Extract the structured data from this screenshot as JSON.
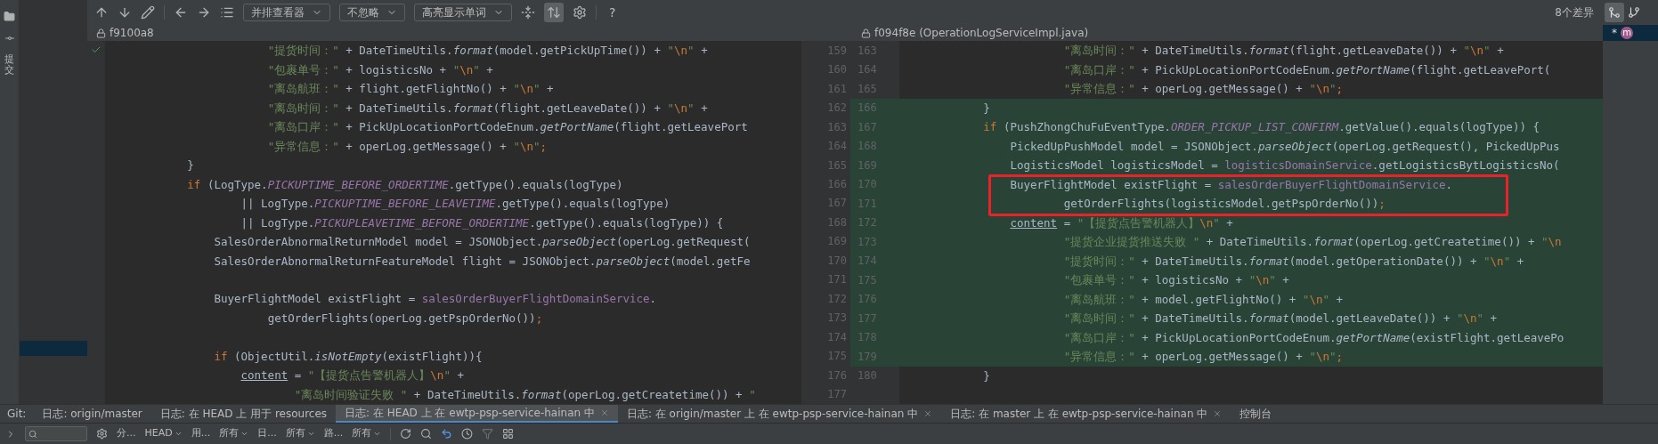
{
  "sidebar": {
    "label": "提交"
  },
  "toolbar": {
    "dropdowns": [
      "并排查看器",
      "不忽略",
      "高亮显示单词"
    ],
    "sync_toggle": {
      "on": true
    },
    "help": "?",
    "diff_count": "8个差异"
  },
  "left_pane": {
    "revision": "f9100a8",
    "lines": [
      {
        "number": "159",
        "code": [
          {
            "kind": "s",
            "text": "                        \"提货时间：\""
          },
          {
            "kind": "p",
            "text": " + DateTimeUtils."
          },
          {
            "kind": "i",
            "text": "format"
          },
          {
            "kind": "p",
            "text": "(model.getPickUpTime()) + "
          },
          {
            "kind": "s",
            "text": "\""
          },
          {
            "kind": "e",
            "text": "\\n"
          },
          {
            "kind": "s",
            "text": "\""
          },
          {
            "kind": "p",
            "text": " +"
          }
        ]
      },
      {
        "number": "160",
        "code": [
          {
            "kind": "s",
            "text": "                        \"包裹单号：\""
          },
          {
            "kind": "p",
            "text": " + logisticsNo + "
          },
          {
            "kind": "s",
            "text": "\""
          },
          {
            "kind": "e",
            "text": "\\n"
          },
          {
            "kind": "s",
            "text": "\""
          },
          {
            "kind": "p",
            "text": " +"
          }
        ]
      },
      {
        "number": "161",
        "code": [
          {
            "kind": "s",
            "text": "                        \"离岛航班：\""
          },
          {
            "kind": "p",
            "text": " + flight.getFlightNo() + "
          },
          {
            "kind": "s",
            "text": "\""
          },
          {
            "kind": "e",
            "text": "\\n"
          },
          {
            "kind": "s",
            "text": "\""
          },
          {
            "kind": "p",
            "text": " +"
          }
        ]
      },
      {
        "number": "162",
        "code": [
          {
            "kind": "s",
            "text": "                        \"离岛时间：\""
          },
          {
            "kind": "p",
            "text": " + DateTimeUtils."
          },
          {
            "kind": "i",
            "text": "format"
          },
          {
            "kind": "p",
            "text": "(flight.getLeaveDate()) + "
          },
          {
            "kind": "s",
            "text": "\""
          },
          {
            "kind": "e",
            "text": "\\n"
          },
          {
            "kind": "s",
            "text": "\""
          },
          {
            "kind": "p",
            "text": " +"
          }
        ]
      },
      {
        "number": "163",
        "code": [
          {
            "kind": "s",
            "text": "                        \"离岛口岸：\""
          },
          {
            "kind": "p",
            "text": " + PickUpLocationPortCodeEnum."
          },
          {
            "kind": "i",
            "text": "getPortName"
          },
          {
            "kind": "p",
            "text": "(flight.getLeavePort"
          }
        ]
      },
      {
        "number": "164",
        "code": [
          {
            "kind": "s",
            "text": "                        \"异常信息：\""
          },
          {
            "kind": "p",
            "text": " + operLog.getMessage() + "
          },
          {
            "kind": "s",
            "text": "\""
          },
          {
            "kind": "e",
            "text": "\\n"
          },
          {
            "kind": "s",
            "text": "\""
          },
          {
            "kind": "k",
            "text": ";"
          }
        ]
      },
      {
        "number": "165",
        "code": [
          {
            "kind": "p",
            "text": "            }"
          }
        ]
      },
      {
        "number": "166",
        "code": [
          {
            "kind": "k",
            "text": "            if"
          },
          {
            "kind": "p",
            "text": " (LogType."
          },
          {
            "kind": "c",
            "text": "PICKUPTIME_BEFORE_ORDERTIME"
          },
          {
            "kind": "p",
            "text": ".getType().equals(logType)"
          }
        ]
      },
      {
        "number": "167",
        "code": [
          {
            "kind": "p",
            "text": "                    || LogType."
          },
          {
            "kind": "c",
            "text": "PICKUPTIME_BEFORE_LEAVETIME"
          },
          {
            "kind": "p",
            "text": ".getType().equals(logType)"
          }
        ]
      },
      {
        "number": "168",
        "code": [
          {
            "kind": "p",
            "text": "                    || LogType."
          },
          {
            "kind": "c",
            "text": "PICKUPLEAVETIME_BEFORE_ORDERTIME"
          },
          {
            "kind": "p",
            "text": ".getType().equals(logType)) {"
          }
        ]
      },
      {
        "number": "169",
        "code": [
          {
            "kind": "p",
            "text": "                SalesOrderAbnormalReturnModel model = JSONObject."
          },
          {
            "kind": "i",
            "text": "parseObject"
          },
          {
            "kind": "p",
            "text": "(operLog.getRequest("
          }
        ]
      },
      {
        "number": "170",
        "code": [
          {
            "kind": "p",
            "text": "                SalesOrderAbnormalReturnFeatureModel flight = JSONObject."
          },
          {
            "kind": "i",
            "text": "parseObject"
          },
          {
            "kind": "p",
            "text": "(model.getFe"
          }
        ]
      },
      {
        "number": "171"
      },
      {
        "number": "172",
        "code": [
          {
            "kind": "p",
            "text": "                BuyerFlightModel existFlight = "
          },
          {
            "kind": "f",
            "text": "salesOrderBuyerFlightDomainService"
          },
          {
            "kind": "p",
            "text": "."
          }
        ]
      },
      {
        "number": "173",
        "code": [
          {
            "kind": "p",
            "text": "                        getOrderFlights(operLog.getPspOrderNo())"
          },
          {
            "kind": "k",
            "text": ";"
          }
        ]
      },
      {
        "number": "174"
      },
      {
        "number": "175",
        "code": [
          {
            "kind": "k",
            "text": "                if"
          },
          {
            "kind": "p",
            "text": " (ObjectUtil."
          },
          {
            "kind": "i",
            "text": "isNotEmpty"
          },
          {
            "kind": "p",
            "text": "(existFlight)){"
          }
        ]
      },
      {
        "number": "176",
        "code": [
          {
            "kind": "u",
            "text": "                    content"
          },
          {
            "kind": "p",
            "text": " = "
          },
          {
            "kind": "s",
            "text": "\"【提货点告警机器人】"
          },
          {
            "kind": "e",
            "text": "\\n"
          },
          {
            "kind": "s",
            "text": "\""
          },
          {
            "kind": "p",
            "text": " +"
          }
        ]
      },
      {
        "number": "177",
        "code": [
          {
            "kind": "s",
            "text": "                            \"离岛时间验证失败 \""
          },
          {
            "kind": "p",
            "text": " + DateTimeUtils."
          },
          {
            "kind": "i",
            "text": "format"
          },
          {
            "kind": "p",
            "text": "(operLog.getCreatetime()) + "
          },
          {
            "kind": "s",
            "text": "\""
          }
        ]
      }
    ]
  },
  "right_pane": {
    "revision": "f094f8e (OperationLogServiceImpl.java)",
    "lines": [
      {
        "number": "163",
        "added": false,
        "boxed": false,
        "code": [
          {
            "kind": "s",
            "text": "                        \"离岛时间：\""
          },
          {
            "kind": "p",
            "text": " + DateTimeUtils."
          },
          {
            "kind": "i",
            "text": "format"
          },
          {
            "kind": "p",
            "text": "(flight.getLeaveDate()) + "
          },
          {
            "kind": "s",
            "text": "\""
          },
          {
            "kind": "e",
            "text": "\\n"
          },
          {
            "kind": "s",
            "text": "\""
          },
          {
            "kind": "p",
            "text": " +"
          }
        ]
      },
      {
        "number": "164",
        "added": false,
        "boxed": false,
        "code": [
          {
            "kind": "s",
            "text": "                        \"离岛口岸：\""
          },
          {
            "kind": "p",
            "text": " + PickUpLocationPortCodeEnum."
          },
          {
            "kind": "i",
            "text": "getPortName"
          },
          {
            "kind": "p",
            "text": "(flight.getLeavePort("
          }
        ]
      },
      {
        "number": "165",
        "added": false,
        "boxed": false,
        "code": [
          {
            "kind": "s",
            "text": "                        \"异常信息：\""
          },
          {
            "kind": "p",
            "text": " + operLog.getMessage() + "
          },
          {
            "kind": "s",
            "text": "\""
          },
          {
            "kind": "e",
            "text": "\\n"
          },
          {
            "kind": "s",
            "text": "\""
          },
          {
            "kind": "k",
            "text": ";"
          }
        ]
      },
      {
        "number": "166",
        "added": true,
        "boxed": false,
        "code": [
          {
            "kind": "p",
            "text": "            }"
          }
        ]
      },
      {
        "number": "167",
        "added": true,
        "boxed": false,
        "code": [
          {
            "kind": "k",
            "text": "            if"
          },
          {
            "kind": "p",
            "text": " (PushZhongChuFuEventType."
          },
          {
            "kind": "c",
            "text": "ORDER_PICKUP_LIST_CONFIRM"
          },
          {
            "kind": "p",
            "text": ".getValue().equals(logType)) {"
          }
        ]
      },
      {
        "number": "168",
        "added": true,
        "boxed": false,
        "code": [
          {
            "kind": "p",
            "text": "                PickedUpPushModel model = JSONObject."
          },
          {
            "kind": "i",
            "text": "parseObject"
          },
          {
            "kind": "p",
            "text": "(operLog.getRequest(), PickedUpPus"
          }
        ]
      },
      {
        "number": "169",
        "added": true,
        "boxed": false,
        "code": [
          {
            "kind": "p",
            "text": "                LogisticsModel logisticsModel = "
          },
          {
            "kind": "f",
            "text": "logisticsDomainService"
          },
          {
            "kind": "p",
            "text": ".getLogisticsBytLogisticsNo("
          }
        ]
      },
      {
        "number": "170",
        "added": true,
        "boxed": true,
        "code": [
          {
            "kind": "p",
            "text": "                BuyerFlightModel existFlight = "
          },
          {
            "kind": "f",
            "text": "salesOrderBuyerFlightDomainService"
          },
          {
            "kind": "p",
            "text": "."
          }
        ]
      },
      {
        "number": "171",
        "added": true,
        "boxed": true,
        "code": [
          {
            "kind": "p",
            "text": "                        getOrderFlights(logisticsModel.getPspOrderNo())"
          },
          {
            "kind": "k",
            "text": ";"
          }
        ]
      },
      {
        "number": "172",
        "added": true,
        "boxed": false,
        "code": [
          {
            "kind": "u",
            "text": "                content"
          },
          {
            "kind": "p",
            "text": " = "
          },
          {
            "kind": "s",
            "text": "\"【提货点告警机器人】"
          },
          {
            "kind": "e",
            "text": "\\n"
          },
          {
            "kind": "s",
            "text": "\""
          },
          {
            "kind": "p",
            "text": " +"
          }
        ]
      },
      {
        "number": "173",
        "added": true,
        "boxed": false,
        "code": [
          {
            "kind": "s",
            "text": "                        \"提货企业提货推送失败 \""
          },
          {
            "kind": "p",
            "text": " + DateTimeUtils."
          },
          {
            "kind": "i",
            "text": "format"
          },
          {
            "kind": "p",
            "text": "(operLog.getCreatetime()) + "
          },
          {
            "kind": "s",
            "text": "\""
          },
          {
            "kind": "e",
            "text": "\\n"
          }
        ]
      },
      {
        "number": "174",
        "added": true,
        "boxed": false,
        "code": [
          {
            "kind": "s",
            "text": "                        \"提货时间：\""
          },
          {
            "kind": "p",
            "text": " + DateTimeUtils."
          },
          {
            "kind": "i",
            "text": "format"
          },
          {
            "kind": "p",
            "text": "(model.getOperationDate()) + "
          },
          {
            "kind": "s",
            "text": "\""
          },
          {
            "kind": "e",
            "text": "\\n"
          },
          {
            "kind": "s",
            "text": "\""
          },
          {
            "kind": "p",
            "text": " +"
          }
        ]
      },
      {
        "number": "175",
        "added": true,
        "boxed": false,
        "code": [
          {
            "kind": "s",
            "text": "                        \"包裹单号：\""
          },
          {
            "kind": "p",
            "text": " + logisticsNo + "
          },
          {
            "kind": "s",
            "text": "\""
          },
          {
            "kind": "e",
            "text": "\\n"
          },
          {
            "kind": "s",
            "text": "\""
          },
          {
            "kind": "p",
            "text": " +"
          }
        ]
      },
      {
        "number": "176",
        "added": true,
        "boxed": false,
        "code": [
          {
            "kind": "s",
            "text": "                        \"离岛航班：\""
          },
          {
            "kind": "p",
            "text": " + model.getFlightNo() + "
          },
          {
            "kind": "s",
            "text": "\""
          },
          {
            "kind": "e",
            "text": "\\n"
          },
          {
            "kind": "s",
            "text": "\""
          },
          {
            "kind": "p",
            "text": " +"
          }
        ]
      },
      {
        "number": "177",
        "added": true,
        "boxed": false,
        "code": [
          {
            "kind": "s",
            "text": "                        \"离岛时间：\""
          },
          {
            "kind": "p",
            "text": " + DateTimeUtils."
          },
          {
            "kind": "i",
            "text": "format"
          },
          {
            "kind": "p",
            "text": "(model.getLeaveDate()) + "
          },
          {
            "kind": "s",
            "text": "\""
          },
          {
            "kind": "e",
            "text": "\\n"
          },
          {
            "kind": "s",
            "text": "\""
          },
          {
            "kind": "p",
            "text": " +"
          }
        ]
      },
      {
        "number": "178",
        "added": true,
        "boxed": false,
        "code": [
          {
            "kind": "s",
            "text": "                        \"离岛口岸：\""
          },
          {
            "kind": "p",
            "text": " + PickUpLocationPortCodeEnum."
          },
          {
            "kind": "i",
            "text": "getPortName"
          },
          {
            "kind": "p",
            "text": "(existFlight.getLeavePo"
          }
        ]
      },
      {
        "number": "179",
        "added": true,
        "boxed": false,
        "code": [
          {
            "kind": "s",
            "text": "                        \"异常信息：\""
          },
          {
            "kind": "p",
            "text": " + operLog.getMessage() + "
          },
          {
            "kind": "s",
            "text": "\""
          },
          {
            "kind": "e",
            "text": "\\n"
          },
          {
            "kind": "s",
            "text": "\""
          },
          {
            "kind": "k",
            "text": ";"
          }
        ]
      },
      {
        "number": "180",
        "added": false,
        "boxed": false,
        "code": [
          {
            "kind": "p",
            "text": "            }"
          }
        ]
      }
    ]
  },
  "right_strip": {
    "marker": "*",
    "avatar": "m"
  },
  "bottom_tabs": {
    "label": "Git:",
    "tabs": [
      {
        "label": "日志: origin/master",
        "selected": false,
        "closable": false
      },
      {
        "label": "日志: 在 HEAD 上 用于 resources",
        "selected": false,
        "closable": false
      },
      {
        "label": "日志: 在 HEAD 上 在 ewtp-psp-service-hainan 中",
        "selected": true,
        "closable": true
      },
      {
        "label": "日志: 在 origin/master 上 在 ewtp-psp-service-hainan 中",
        "selected": false,
        "closable": true
      },
      {
        "label": "日志: 在 master 上 在 ewtp-psp-service-hainan 中",
        "selected": false,
        "closable": true
      },
      {
        "label": "控制台",
        "selected": false,
        "closable": false
      }
    ]
  },
  "log_toolbar": {
    "filters": [
      {
        "label": "分...",
        "value": "HEAD"
      },
      {
        "label": "用...",
        "value": "所有"
      },
      {
        "label": "日...",
        "value": "所有"
      },
      {
        "label": "路...",
        "value": "所有"
      }
    ]
  }
}
